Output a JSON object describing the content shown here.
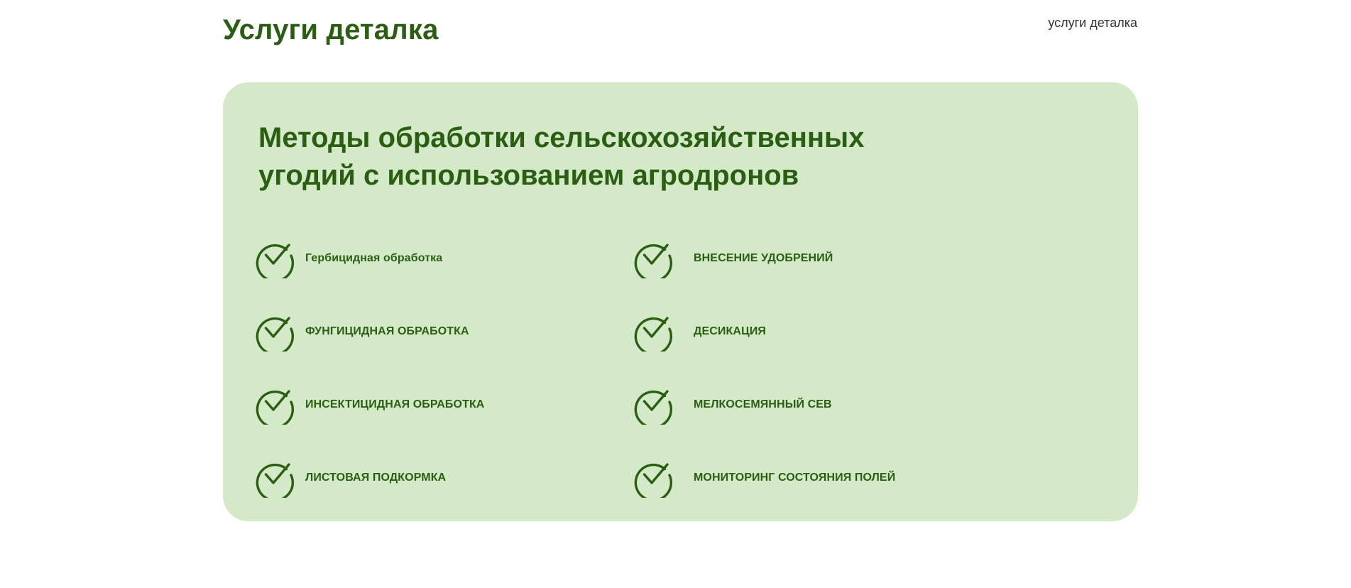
{
  "header": {
    "title": "Услуги деталка",
    "breadcrumb": "услуги деталка"
  },
  "card": {
    "title": "Методы обработки сельскохозяйственных угодий с использованием агродронов",
    "icon": "check-circle-icon",
    "accent_color": "#2a5e12",
    "background_color": "#d4e9c7",
    "items": [
      {
        "label": "Гербицидная обработка"
      },
      {
        "label": "ВНЕСЕНИЕ УДОБРЕНИЙ"
      },
      {
        "label": "ФУНГИЦИДНАЯ ОБРАБОТКА"
      },
      {
        "label": "ДЕСИКАЦИЯ"
      },
      {
        "label": "ИНСЕКТИЦИДНАЯ ОБРАБОТКА"
      },
      {
        "label": "МЕЛКОСЕМЯННЫЙ СЕВ"
      },
      {
        "label": "ЛИСТОВАЯ ПОДКОРМКА"
      },
      {
        "label": "МОНИТОРИНГ СОСТОЯНИЯ ПОЛЕЙ"
      }
    ]
  }
}
